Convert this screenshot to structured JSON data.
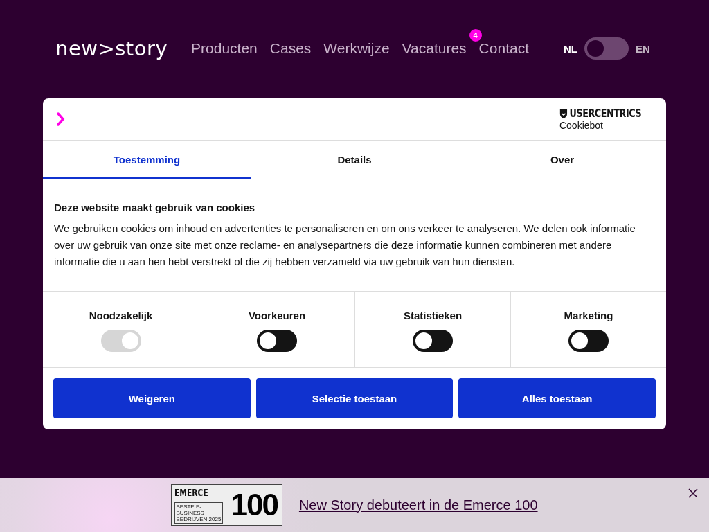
{
  "header": {
    "logo": "new>story",
    "nav": [
      {
        "label": "Producten"
      },
      {
        "label": "Cases"
      },
      {
        "label": "Werkwijze"
      },
      {
        "label": "Vacatures",
        "badge": "4"
      },
      {
        "label": "Contact"
      }
    ],
    "language": {
      "left": "NL",
      "right": "EN",
      "on": false
    }
  },
  "cookie_dialog": {
    "brand": {
      "name": "USERCENTRICS",
      "product": "Cookiebot"
    },
    "tabs": [
      {
        "label": "Toestemming",
        "selected": true
      },
      {
        "label": "Details",
        "selected": false
      },
      {
        "label": "Over",
        "selected": false
      }
    ],
    "title": "Deze website maakt gebruik van cookies",
    "text": "We gebruiken cookies om inhoud en advertenties te personaliseren en om ons verkeer te analyseren. We delen ook informatie over uw gebruik van onze site met onze reclame- en analysepartners die deze informatie kunnen combineren met andere informatie die u aan hen hebt verstrekt of die zij hebben verzameld via uw gebruik van hun diensten.",
    "categories": [
      {
        "label": "Noodzakelijk",
        "on": true,
        "disabled": true
      },
      {
        "label": "Voorkeuren",
        "on": false,
        "disabled": false
      },
      {
        "label": "Statistieken",
        "on": false,
        "disabled": false
      },
      {
        "label": "Marketing",
        "on": false,
        "disabled": false
      }
    ],
    "buttons": [
      "Weigeren",
      "Selectie toestaan",
      "Alles toestaan"
    ]
  },
  "banner": {
    "badge": {
      "name": "EMERCE",
      "subtitle": "BESTE E-BUSINESS BEDRIJVEN 2025",
      "number": "100"
    },
    "link": "New Story debuteert in de Emerce 100"
  }
}
